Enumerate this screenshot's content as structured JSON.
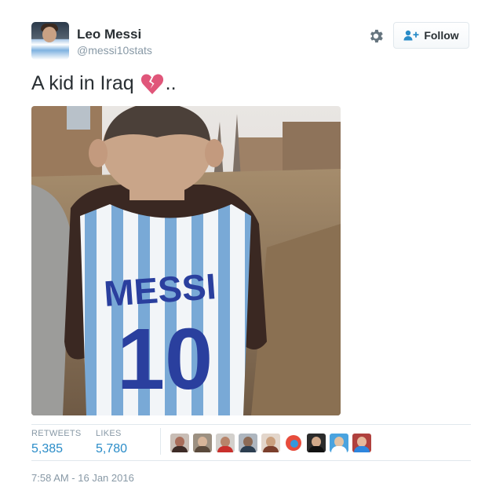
{
  "tweet": {
    "author_name": "Leo Messi",
    "author_handle": "@messi10stats",
    "text": "A kid in Iraq",
    "text_suffix": "..",
    "emoji": "broken-heart-icon",
    "image_shirt_text": "MESSI",
    "image_shirt_number": "10"
  },
  "actions": {
    "follow_label": "Follow",
    "settings_icon": "gear-icon",
    "follow_icon": "add-user-icon"
  },
  "stats": {
    "retweets_label": "RETWEETS",
    "retweets_value": "5,385",
    "likes_label": "LIKES",
    "likes_value": "5,780"
  },
  "timestamp": "7:58 AM - 16 Jan 2016",
  "colors": {
    "link_blue": "#2a8cc8",
    "muted_gray": "#8899a6",
    "text_dark": "#292f33",
    "heart_pink": "#e0567a"
  },
  "liker_avatars_count": 9
}
